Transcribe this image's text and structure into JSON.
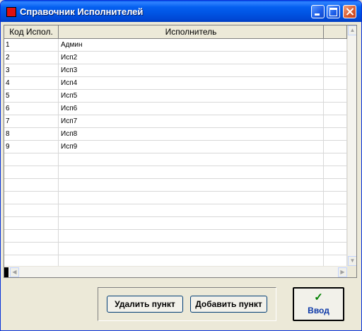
{
  "window": {
    "title": "Справочник Исполнителей",
    "icon": "app-icon"
  },
  "grid": {
    "columns": [
      "Код Испол.",
      "Исполнитель",
      ""
    ],
    "rows": [
      [
        "1",
        "Админ"
      ],
      [
        "2",
        "Исп2"
      ],
      [
        "3",
        "Исп3"
      ],
      [
        "4",
        "Исп4"
      ],
      [
        "5",
        "Исп5"
      ],
      [
        "6",
        "Исп6"
      ],
      [
        "7",
        "Исп7"
      ],
      [
        "8",
        "Исп8"
      ],
      [
        "9",
        "Исп9"
      ],
      [
        "",
        ""
      ],
      [
        "",
        ""
      ],
      [
        "",
        ""
      ],
      [
        "",
        ""
      ],
      [
        "",
        ""
      ],
      [
        "",
        ""
      ],
      [
        "",
        ""
      ],
      [
        "",
        ""
      ],
      [
        "",
        ""
      ]
    ]
  },
  "buttons": {
    "delete": "Удалить пункт",
    "add": "Добавить пункт",
    "ok": "Ввод",
    "ok_check": "✓"
  },
  "colors": {
    "titlebar": "#0054e3",
    "check": "#008000",
    "ok_label": "#0c38a8"
  }
}
